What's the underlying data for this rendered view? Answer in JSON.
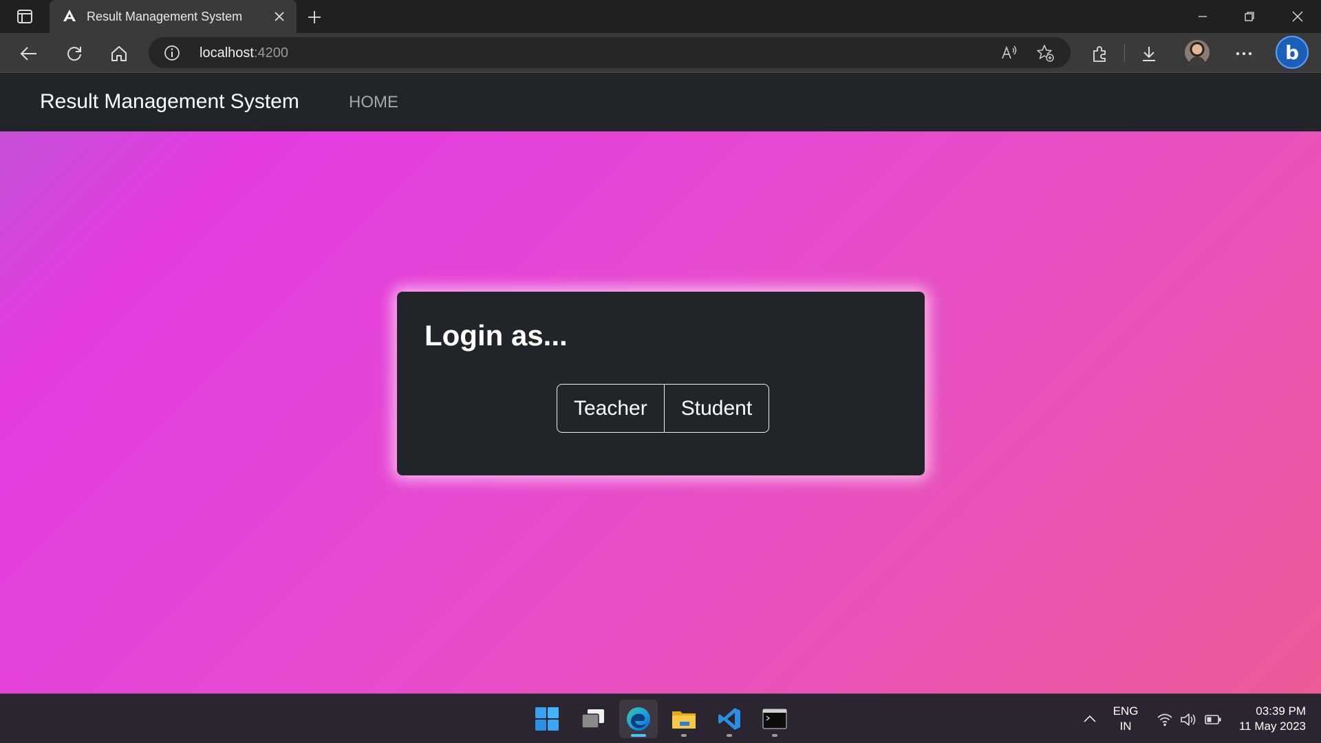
{
  "browser": {
    "tab": {
      "title": "Result Management System"
    },
    "address": {
      "host": "localhost",
      "port": ":4200"
    }
  },
  "page": {
    "navbar": {
      "brand": "Result Management System",
      "link": "HOME"
    },
    "card": {
      "title": "Login as...",
      "buttons": [
        "Teacher",
        "Student"
      ]
    }
  },
  "taskbar": {
    "language": {
      "line1": "ENG",
      "line2": "IN"
    },
    "time": "03:39 PM",
    "date": "11 May 2023"
  },
  "colors": {
    "navbar": "#212529",
    "card": "#212529",
    "gradient_start": "#c44fd6",
    "gradient_end": "#ea5b97"
  }
}
